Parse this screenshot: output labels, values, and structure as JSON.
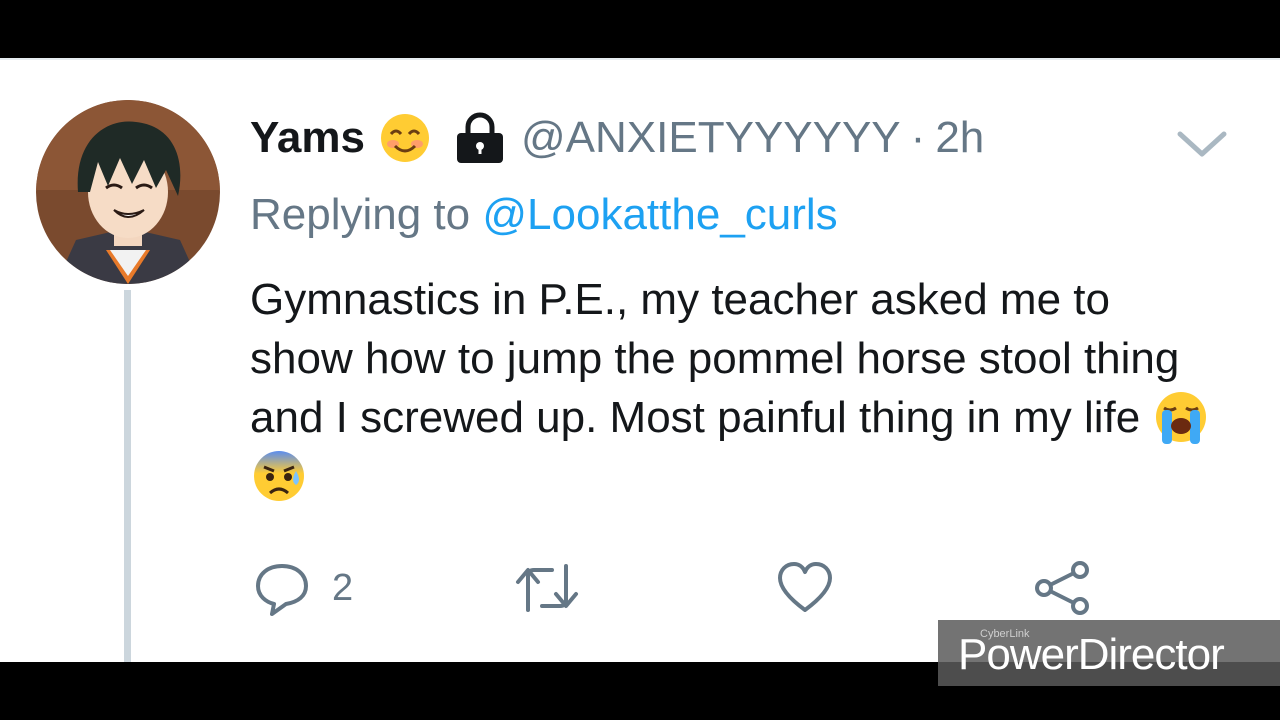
{
  "tweet": {
    "display_name": "Yams",
    "name_emoji": "smiling-face-emoji",
    "protected_icon": "lock-icon",
    "handle": "@ANXIETYYYYYY",
    "separator": "·",
    "time": "2h",
    "replying_prefix": "Replying to",
    "replying_handle": "@Lookatthe_curls",
    "text": "Gymnastics in P.E., my teacher asked me to show how to jump the pommel horse stool thing and I screwed up. Most painful thing in my life",
    "trailing_emojis": [
      "loudly-crying-face-emoji",
      "anxious-face-with-sweat-emoji"
    ]
  },
  "actions": {
    "reply_count": "2",
    "icons": [
      "reply-icon",
      "retweet-icon",
      "like-icon",
      "share-icon"
    ]
  },
  "watermark": {
    "small": "CyberLink",
    "big": "PowerDirector"
  },
  "colors": {
    "text": "#14171a",
    "secondary": "#657786",
    "link": "#1da1f2",
    "thread_line": "#ccd6dd",
    "letterbox": "#000000"
  }
}
